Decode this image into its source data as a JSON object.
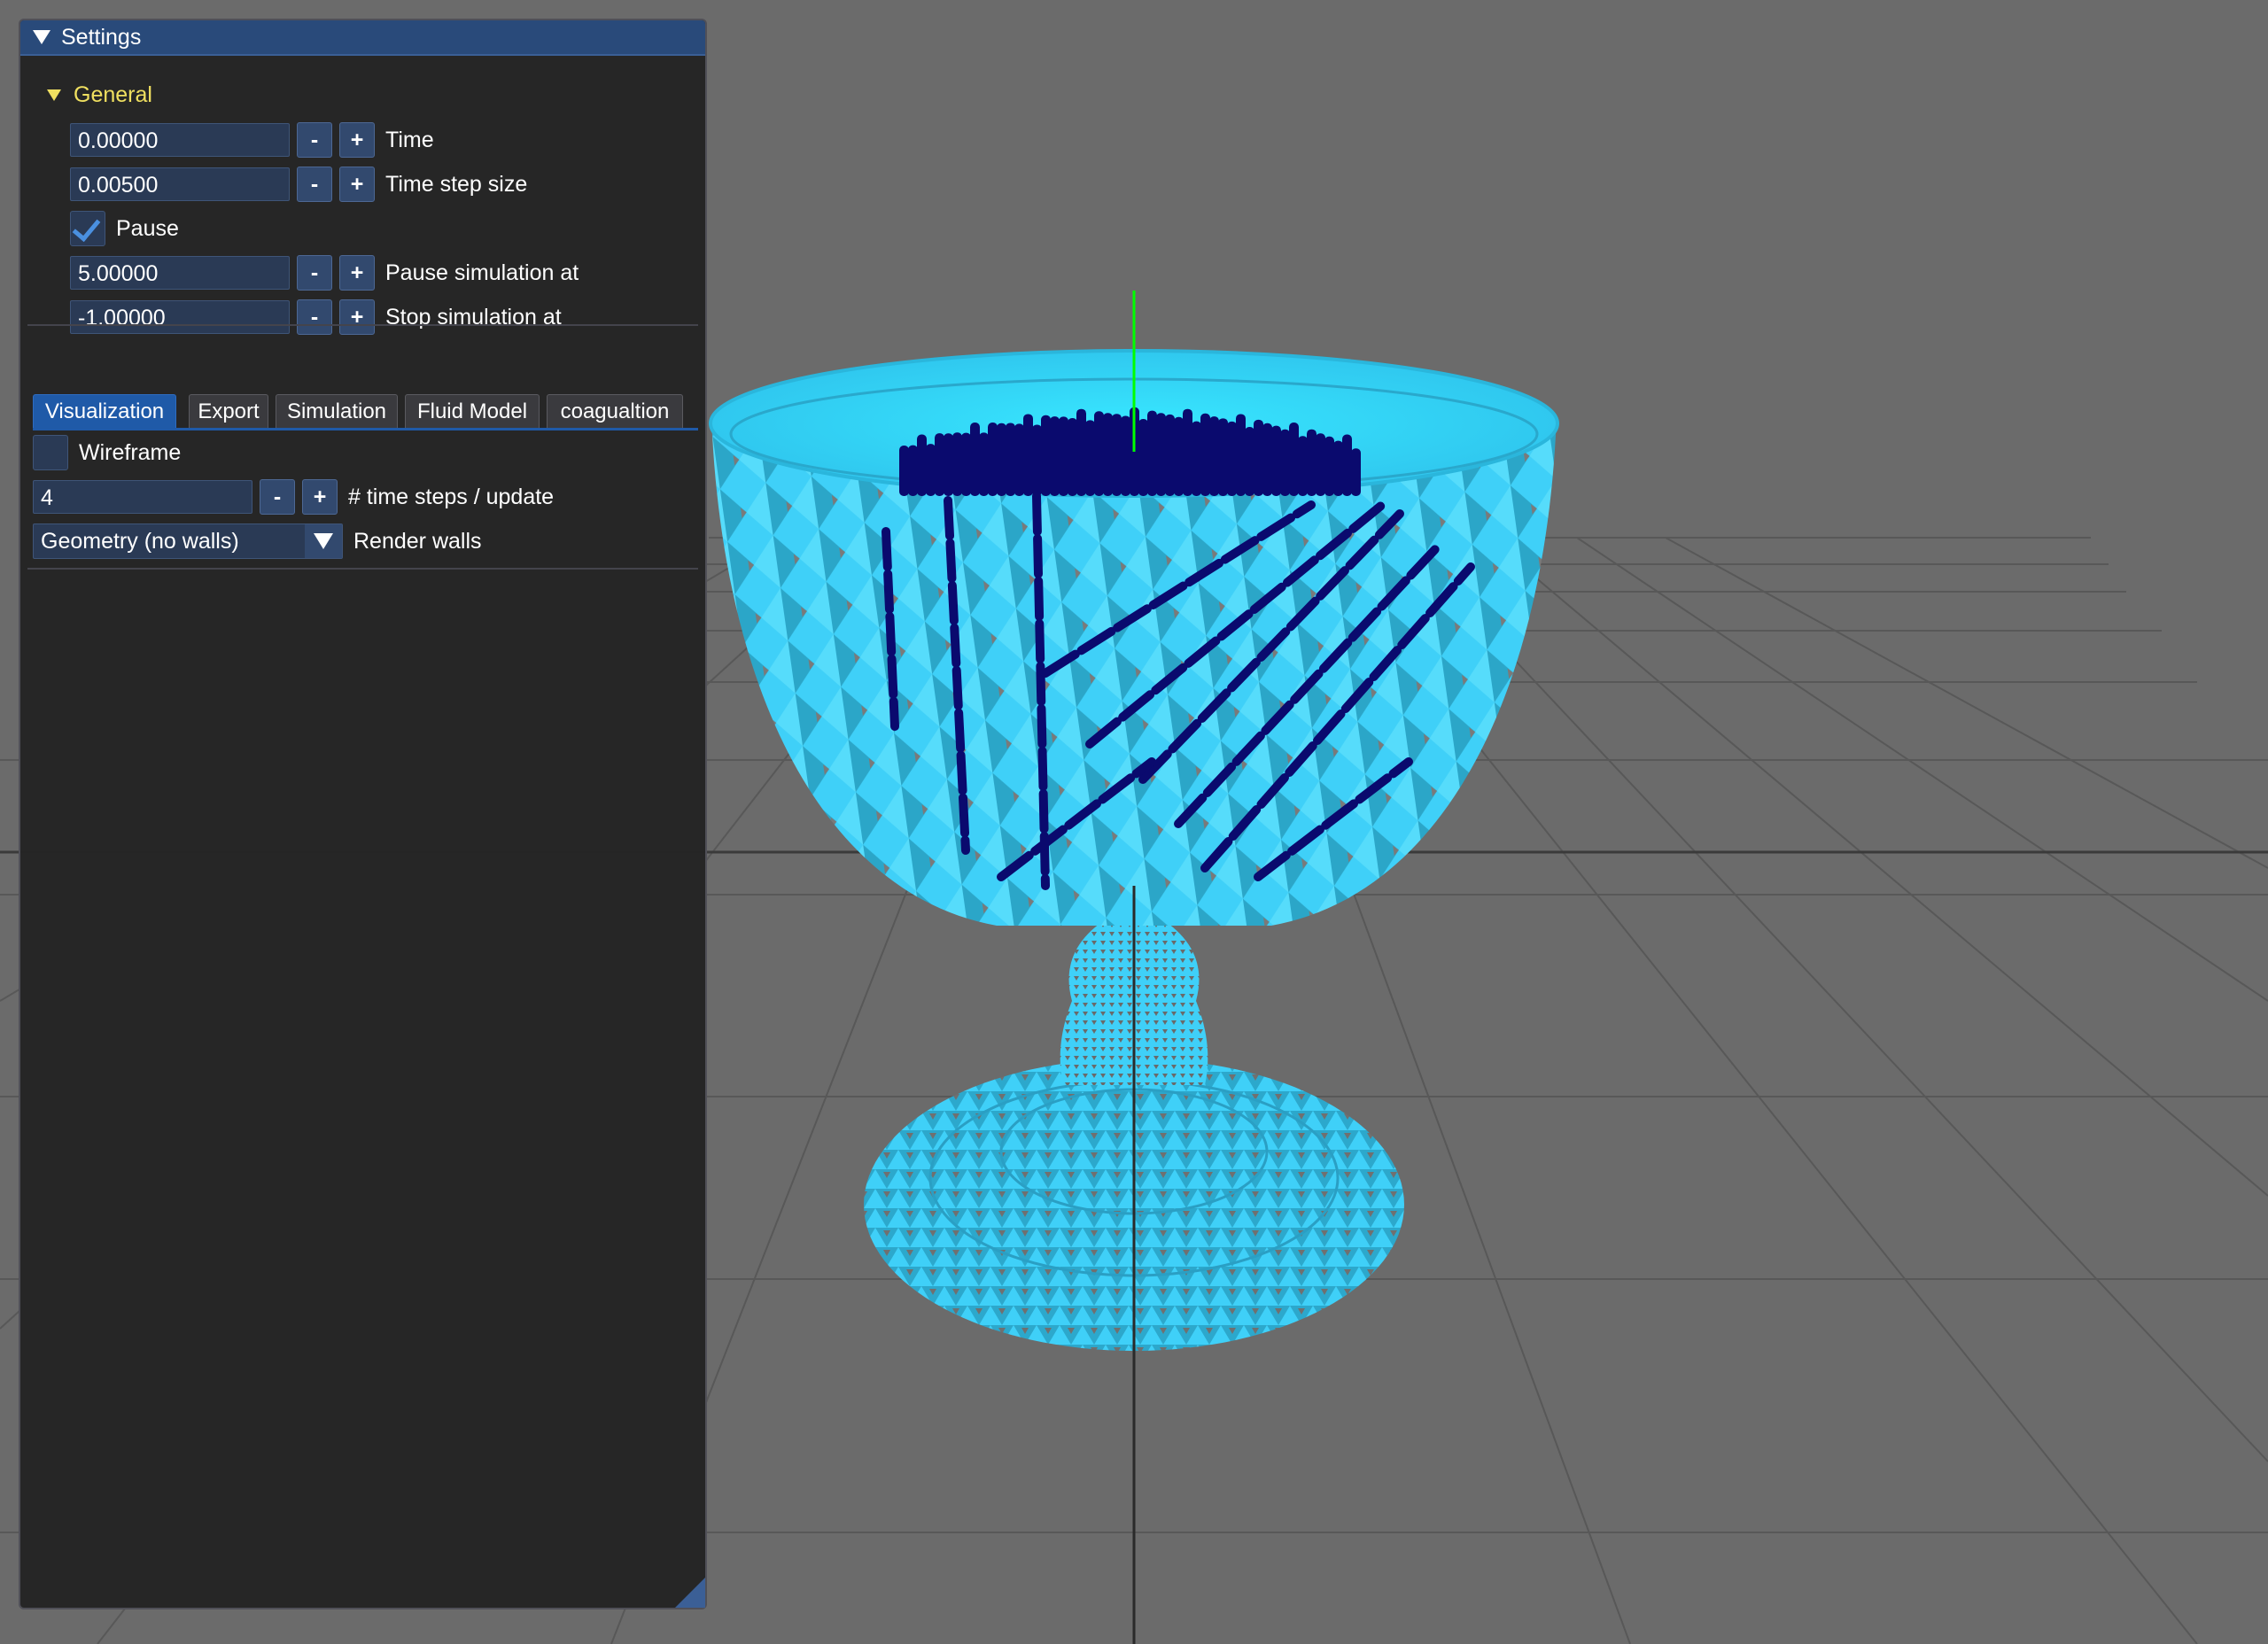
{
  "window": {
    "title": "Settings",
    "section": "General"
  },
  "general": {
    "time": {
      "value": "0.00000",
      "label": "Time"
    },
    "time_step": {
      "value": "0.00500",
      "label": "Time step size"
    },
    "pause": {
      "label": "Pause",
      "checked": true
    },
    "pause_at": {
      "value": "5.00000",
      "label": "Pause simulation at"
    },
    "stop_at": {
      "value": "-1.00000",
      "label": "Stop simulation at"
    }
  },
  "buttons": {
    "minus": "-",
    "plus": "+"
  },
  "tabs": [
    {
      "label": "Visualization",
      "active": true
    },
    {
      "label": "Export"
    },
    {
      "label": "Simulation"
    },
    {
      "label": "Fluid Model"
    },
    {
      "label": "coagualtion"
    }
  ],
  "visualization": {
    "wireframe": {
      "label": "Wireframe",
      "checked": false
    },
    "steps_per_update": {
      "value": "4",
      "label": "# time steps / update"
    },
    "render_walls": {
      "selected": "Geometry (no walls)",
      "label": "Render walls"
    }
  },
  "colors": {
    "background": "#6b6b6b",
    "mesh": "#3fd0f8",
    "particles": "#0a0a6e",
    "axis_y": "#00ff00",
    "accent": "#1f5aa8"
  }
}
